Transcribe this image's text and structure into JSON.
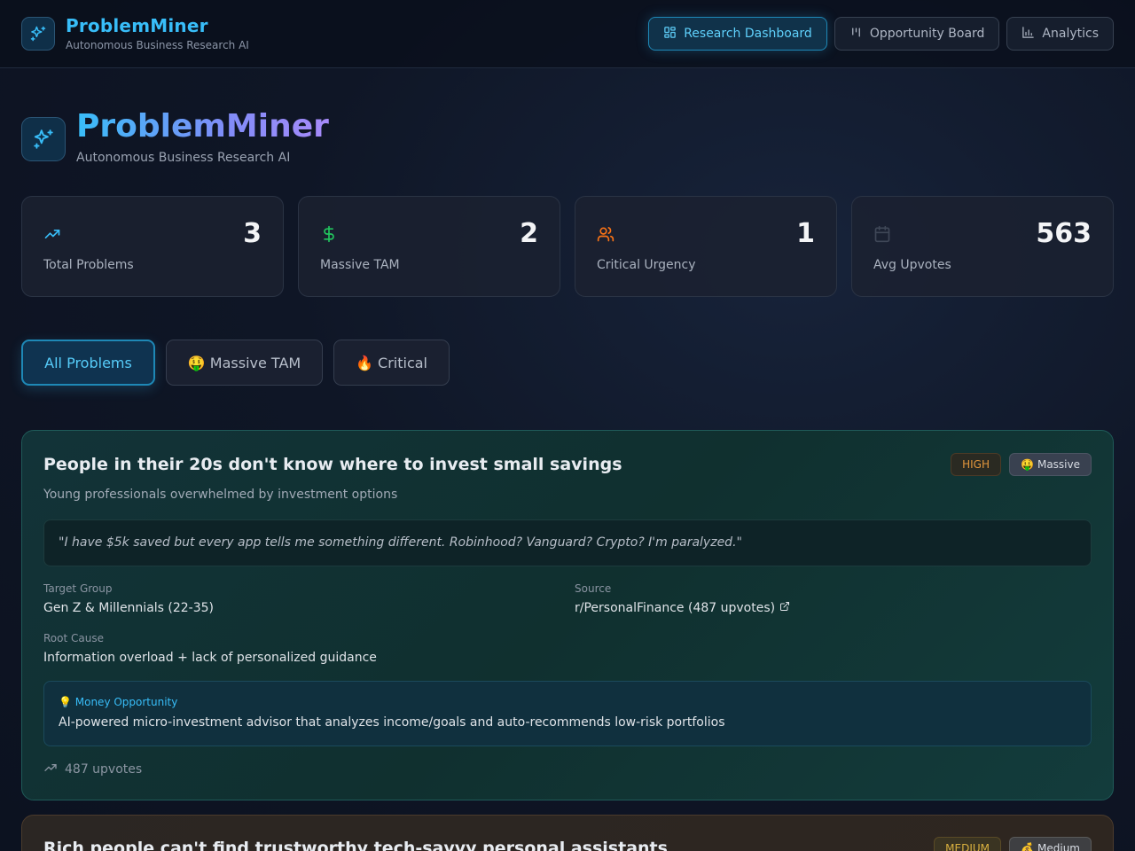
{
  "header": {
    "app_name": "ProblemMiner",
    "app_subtitle": "Autonomous Business Research AI",
    "nav": [
      {
        "label": "Research Dashboard",
        "icon": "grid-icon",
        "active": true
      },
      {
        "label": "Opportunity Board",
        "icon": "kanban-icon",
        "active": false
      },
      {
        "label": "Analytics",
        "icon": "bar-chart-icon",
        "active": false
      }
    ]
  },
  "hero": {
    "title": "ProblemMiner",
    "subtitle": "Autonomous Business Research AI"
  },
  "stats": [
    {
      "value": "3",
      "label": "Total Problems",
      "icon": "trending-up-icon",
      "color": "#38bdf8"
    },
    {
      "value": "2",
      "label": "Massive TAM",
      "icon": "dollar-icon",
      "color": "#22c55e"
    },
    {
      "value": "1",
      "label": "Critical Urgency",
      "icon": "users-icon",
      "color": "#f97316"
    },
    {
      "value": "563",
      "label": "Avg Upvotes",
      "icon": "calendar-icon",
      "color": "#4b5563"
    }
  ],
  "filters": [
    {
      "label": "All Problems",
      "active": true
    },
    {
      "label": "🤑 Massive TAM",
      "active": false
    },
    {
      "label": "🔥 Critical",
      "active": false
    }
  ],
  "problems": [
    {
      "title": "People in their 20s don't know where to invest small savings",
      "description": "Young professionals overwhelmed by investment options",
      "urgency": "HIGH",
      "tam": "🤑 Massive",
      "quote": "\"I have $5k saved but every app tells me something different. Robinhood? Vanguard? Crypto? I'm paralyzed.\"",
      "target_group_label": "Target Group",
      "target_group": "Gen Z & Millennials (22-35)",
      "source_label": "Source",
      "source": "r/PersonalFinance (487 upvotes)",
      "root_cause_label": "Root Cause",
      "root_cause": "Information overload + lack of personalized guidance",
      "opportunity_label": "💡 Money Opportunity",
      "opportunity": "AI-powered micro-investment advisor that analyzes income/goals and auto-recommends low-risk portfolios",
      "upvotes": "487 upvotes"
    },
    {
      "title": "Rich people can't find trustworthy tech-savvy personal assistants",
      "urgency": "MEDIUM",
      "tam": "💰 Medium"
    }
  ],
  "colors": {
    "accent": "#38bdf8",
    "high_urgency": "#e2963c",
    "medium_urgency": "#d9b03f"
  }
}
